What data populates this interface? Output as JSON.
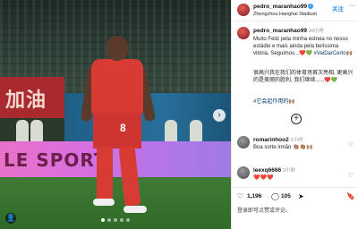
{
  "photo": {
    "banner_text": "加油",
    "board_text": "LE SPORT",
    "jersey_number": "8",
    "next_icon": "chevron-right-icon",
    "carousel_total": 5,
    "carousel_active": 1,
    "tag_icon": "person-tag-icon"
  },
  "post": {
    "username": "pedro_maranhao99",
    "follow_label": "关注",
    "more_label": "···",
    "location": "Zhengzhou Hanghai Stadium",
    "caption_user": "pedro_maranhao99",
    "caption_time": "10小时",
    "caption_pt": "Muito Feliz pela minha estreia no nosso estádio e mais ainda pela belíssima vitória, Seguimos...❤️💚",
    "caption_hashtag": "#VaiDarCerto🙌🏽",
    "caption_cn": "很高兴我在我们的体育场首次亮相, 更高兴的是美丽的胜利, 我们继续......❤️💚",
    "caption_tag": "#它会起作用的🙌🏽",
    "add_comment": "+"
  },
  "comments": [
    {
      "user": "romarinhoo2",
      "time": "2小时",
      "text": "Boa sorte irmão 👏🏽👏🏽🙌🏽"
    },
    {
      "user": "leexq6666",
      "time": "2小时",
      "text": "❤️❤️❤️"
    }
  ],
  "actions": {
    "likes": "1,196",
    "comments": "105",
    "like_icon": "heart-icon",
    "comment_icon": "comment-icon",
    "share_icon": "share-icon",
    "save_icon": "bookmark-icon"
  },
  "footer": {
    "signin_text": "登录即可点赞或评论。"
  },
  "colors": {
    "jersey": "#d83a34",
    "link": "#3897f0",
    "hashtag": "#00376b"
  }
}
